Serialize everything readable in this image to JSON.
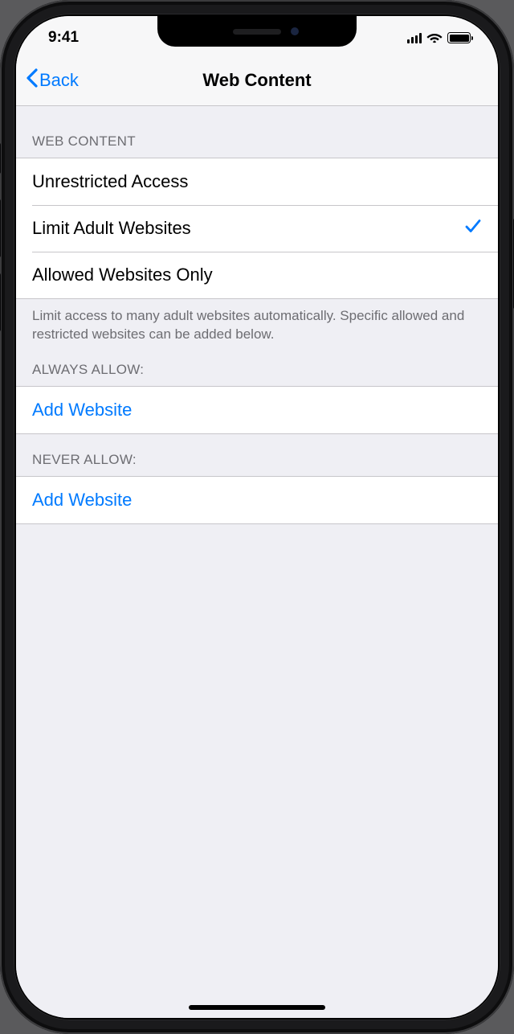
{
  "status": {
    "time": "9:41"
  },
  "nav": {
    "back_label": "Back",
    "title": "Web Content"
  },
  "sections": {
    "web_content": {
      "header": "WEB CONTENT",
      "options": [
        {
          "label": "Unrestricted Access",
          "selected": false
        },
        {
          "label": "Limit Adult Websites",
          "selected": true
        },
        {
          "label": "Allowed Websites Only",
          "selected": false
        }
      ],
      "footer": "Limit access to many adult websites automatically. Specific allowed and restricted websites can be added below."
    },
    "always_allow": {
      "header": "ALWAYS ALLOW:",
      "add_label": "Add Website"
    },
    "never_allow": {
      "header": "NEVER ALLOW:",
      "add_label": "Add Website"
    }
  }
}
